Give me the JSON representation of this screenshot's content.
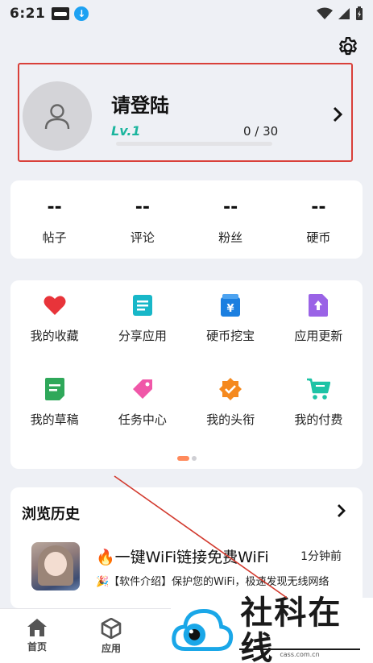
{
  "status_bar": {
    "time": "6:21"
  },
  "profile": {
    "title": "请登陆",
    "level": "Lv.1",
    "exp": "0 / 30",
    "exp_progress": 0
  },
  "stats": [
    {
      "value": "--",
      "label": "帖子"
    },
    {
      "value": "--",
      "label": "评论"
    },
    {
      "value": "--",
      "label": "粉丝"
    },
    {
      "value": "--",
      "label": "硬币"
    }
  ],
  "menu": [
    {
      "label": "我的收藏",
      "icon": "heart-icon",
      "color": "#e8343a"
    },
    {
      "label": "分享应用",
      "icon": "document-share-icon",
      "color": "#18b7c8"
    },
    {
      "label": "硬币挖宝",
      "icon": "coin-bag-icon",
      "color": "#1b7fe0"
    },
    {
      "label": "应用更新",
      "icon": "upload-file-icon",
      "color": "#9a63e6"
    },
    {
      "label": "我的草稿",
      "icon": "draft-icon",
      "color": "#2fa85a"
    },
    {
      "label": "任务中心",
      "icon": "tag-icon",
      "color": "#f057a8"
    },
    {
      "label": "我的头衔",
      "icon": "badge-icon",
      "color": "#f5891e"
    },
    {
      "label": "我的付费",
      "icon": "cart-icon",
      "color": "#1ec3a6"
    }
  ],
  "history": {
    "title": "浏览历史",
    "item": {
      "name": "🔥一键WiFi链接免费WiFi",
      "time": "1分钟前",
      "desc": "🎉【软件介绍】保护您的WiFi，极速发现无线网络"
    }
  },
  "bottom_nav": [
    {
      "label": "首页",
      "icon": "home-icon"
    },
    {
      "label": "应用",
      "icon": "cube-icon"
    }
  ],
  "watermark": {
    "text": "社科在线",
    "sub": "cass.com.cn"
  }
}
